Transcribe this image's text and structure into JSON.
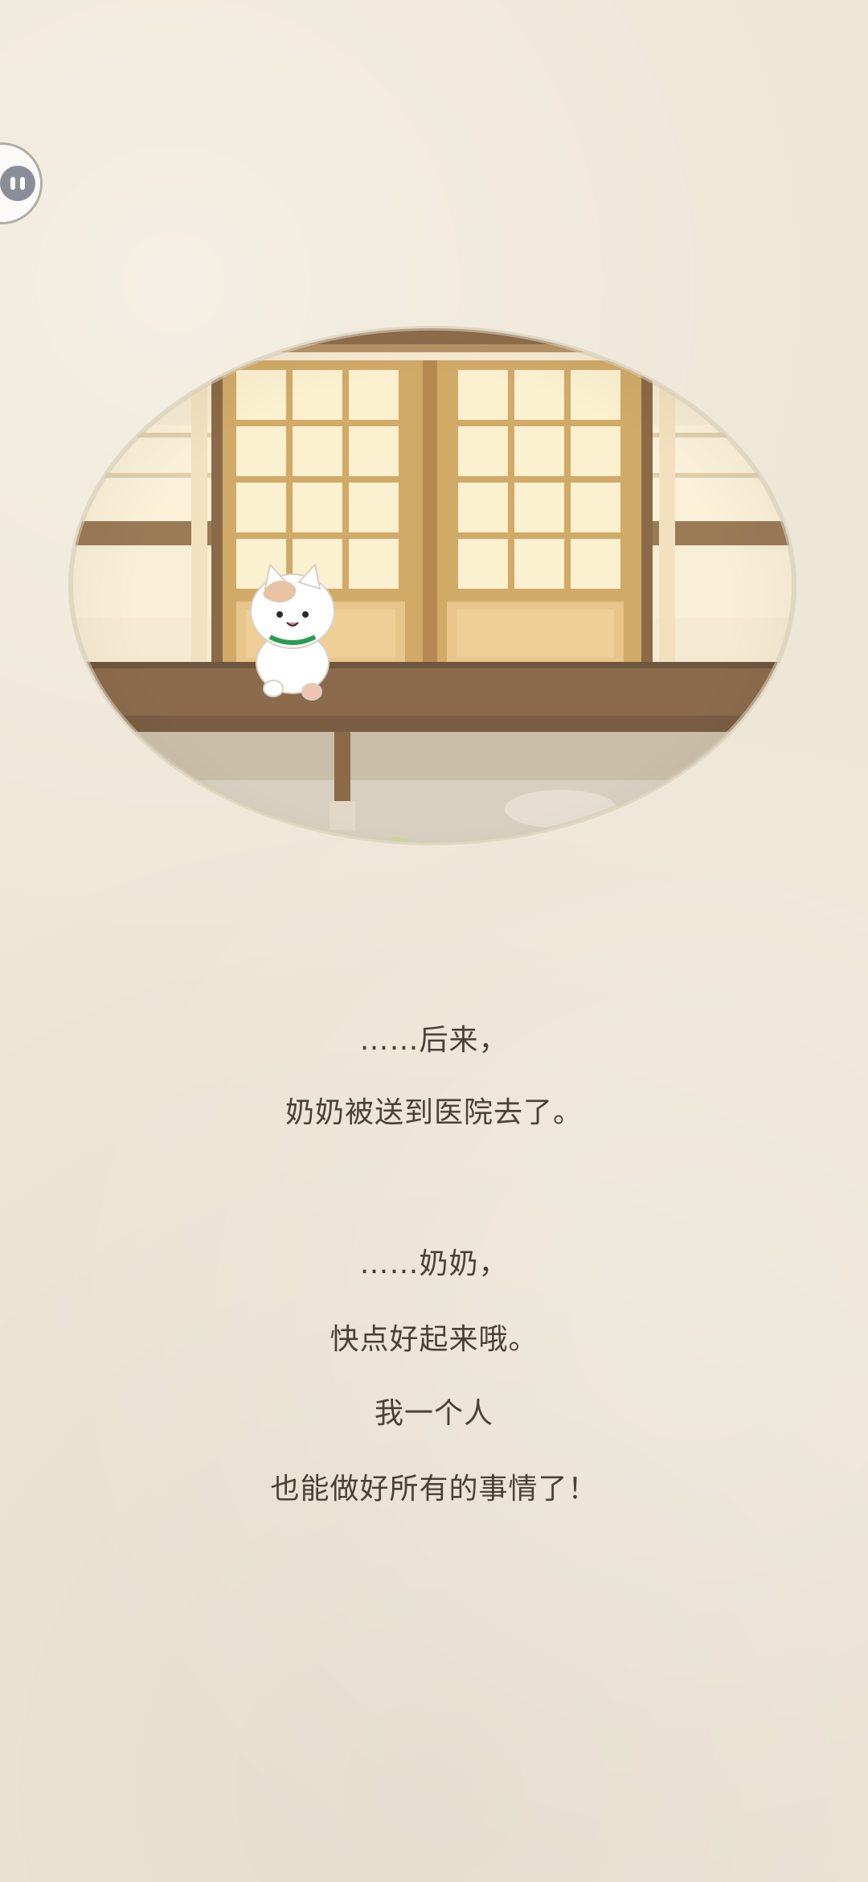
{
  "ui": {
    "pause_button_icon": "pause-icon"
  },
  "story": {
    "paragraph1": {
      "line1": "……后来，",
      "line2": "奶奶被送到医院去了。"
    },
    "paragraph2": {
      "line1": "……奶奶，",
      "line2": "快点好起来哦。",
      "line3": "我一个人",
      "line4": "也能做好所有的事情了！"
    }
  },
  "colors": {
    "background": "#eee6d6",
    "text": "#4a4136",
    "wood": "#9b7a56",
    "shoji": "#f9eecf"
  }
}
